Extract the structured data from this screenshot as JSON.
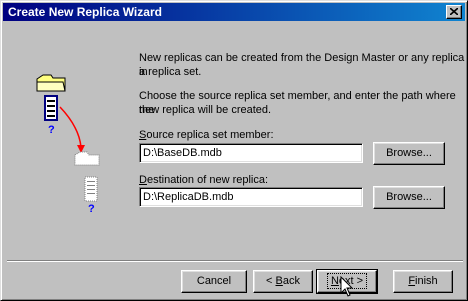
{
  "window": {
    "title": "Create New Replica Wizard"
  },
  "intro": {
    "line1": "New replicas can be created from the Design Master or any replica in",
    "line2": "a replica set.",
    "line3": "Choose the source replica set member, and enter the path where the",
    "line4": "new replica will be created."
  },
  "source": {
    "label_mn": "S",
    "label_rest": "ource replica set member:",
    "value": "D:\\BaseDB.mdb",
    "browse": "Browse..."
  },
  "destination": {
    "label_mn": "D",
    "label_rest": "estination of new replica:",
    "value": "D:\\ReplicaDB.mdb",
    "browse": "Browse..."
  },
  "buttons": {
    "cancel": "Cancel",
    "back_prefix": "< ",
    "back_mn": "B",
    "back_rest": "ack",
    "next_mn": "N",
    "next_rest": "ext >",
    "finish_mn": "F",
    "finish_rest": "inish"
  },
  "illustration": {
    "question_top": "?",
    "question_bottom": "?"
  },
  "colors": {
    "title_start": "#000080",
    "title_end": "#1084d0",
    "arrow": "#ff0000",
    "face": "#c0c0c0"
  }
}
